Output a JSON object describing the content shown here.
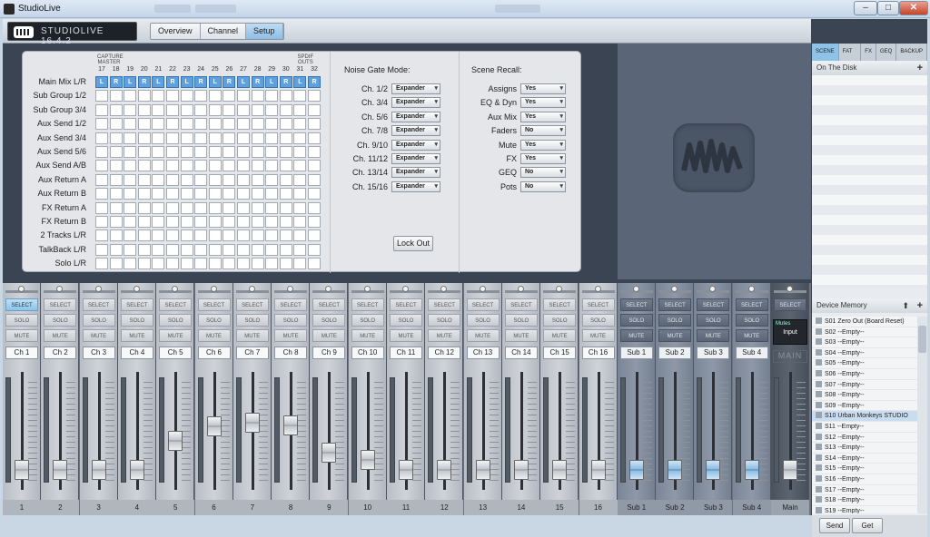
{
  "window": {
    "title": "StudioLive"
  },
  "app": {
    "logo_text": "STUDIOLIVE 16.4.2",
    "tabs": [
      "Overview",
      "Channel",
      "Setup"
    ],
    "active_tab": "Setup"
  },
  "routing": {
    "group_labels": [
      "CAPTURE MASTER",
      "SPDIF OUTS"
    ],
    "channels": [
      "17",
      "18",
      "19",
      "20",
      "21",
      "22",
      "23",
      "24",
      "25",
      "26",
      "27",
      "28",
      "29",
      "30",
      "31",
      "32"
    ],
    "main_mix_row": [
      "L",
      "R",
      "L",
      "R",
      "L",
      "R",
      "L",
      "R",
      "L",
      "R",
      "L",
      "R",
      "L",
      "R",
      "L",
      "R"
    ],
    "rows": [
      "Main Mix L/R",
      "Sub Group 1/2",
      "Sub Group 3/4",
      "Aux Send 1/2",
      "Aux Send 3/4",
      "Aux Send 5/6",
      "Aux Send A/B",
      "Aux Return A",
      "Aux Return B",
      "FX Return A",
      "FX Return B",
      "2 Tracks L/R",
      "TalkBack L/R",
      "Solo L/R"
    ]
  },
  "noise_gate": {
    "title": "Noise Gate Mode:",
    "items": [
      {
        "label": "Ch. 1/2",
        "value": "Expander"
      },
      {
        "label": "Ch. 3/4",
        "value": "Expander"
      },
      {
        "label": "Ch. 5/6",
        "value": "Expander"
      },
      {
        "label": "Ch. 7/8",
        "value": "Expander"
      },
      {
        "label": "Ch. 9/10",
        "value": "Expander"
      },
      {
        "label": "Ch. 11/12",
        "value": "Expander"
      },
      {
        "label": "Ch. 13/14",
        "value": "Expander"
      },
      {
        "label": "Ch. 15/16",
        "value": "Expander"
      }
    ],
    "lock_out": "Lock Out"
  },
  "scene_recall": {
    "title": "Scene Recall:",
    "items": [
      {
        "label": "Assigns",
        "value": "Yes"
      },
      {
        "label": "EQ & Dyn",
        "value": "Yes"
      },
      {
        "label": "Aux Mix",
        "value": "Yes"
      },
      {
        "label": "Faders",
        "value": "No"
      },
      {
        "label": "Mute",
        "value": "Yes"
      },
      {
        "label": "FX",
        "value": "Yes"
      },
      {
        "label": "GEQ",
        "value": "No"
      },
      {
        "label": "Pots",
        "value": "No"
      }
    ]
  },
  "right_panel": {
    "tabs": [
      "SCENE",
      "FAT CH",
      "FX",
      "GEQ",
      "BACKUP"
    ],
    "active_tab": "SCENE",
    "on_disk": "On The Disk",
    "device_memory": "Device Memory",
    "memory": [
      "S01 Zero Out (Board Reset)",
      "S02 --Empty--",
      "S03 --Empty--",
      "S04 --Empty--",
      "S05 --Empty--",
      "S06 --Empty--",
      "S07 --Empty--",
      "S08 --Empty--",
      "S09 --Empty--",
      "S10 Urban Monkeys STUDIO",
      "S11 --Empty--",
      "S12 --Empty--",
      "S13 --Empty--",
      "S14 --Empty--",
      "S15 --Empty--",
      "S16 --Empty--",
      "S17 --Empty--",
      "S18 --Empty--",
      "S19 --Empty--"
    ],
    "selected_memory": "S10 Urban Monkeys STUDIO",
    "send": "Send",
    "get": "Get"
  },
  "mixer": {
    "select": "SELECT",
    "solo": "SOLO",
    "mute": "MUTE",
    "mutes_label": "Mutes",
    "input_label": "Input",
    "main_label": "MAIN",
    "channels": [
      {
        "name": "Ch 1",
        "num": "1",
        "fader": 0.1,
        "selected": true
      },
      {
        "name": "Ch 2",
        "num": "2",
        "fader": 0.1
      },
      {
        "name": "Ch 3",
        "num": "3",
        "fader": 0.1
      },
      {
        "name": "Ch 4",
        "num": "4",
        "fader": 0.1
      },
      {
        "name": "Ch 5",
        "num": "5",
        "fader": 0.4
      },
      {
        "name": "Ch 6",
        "num": "6",
        "fader": 0.55
      },
      {
        "name": "Ch 7",
        "num": "7",
        "fader": 0.58
      },
      {
        "name": "Ch 8",
        "num": "8",
        "fader": 0.56
      },
      {
        "name": "Ch 9",
        "num": "9",
        "fader": 0.28
      },
      {
        "name": "Ch 10",
        "num": "10",
        "fader": 0.2
      },
      {
        "name": "Ch 11",
        "num": "11",
        "fader": 0.1
      },
      {
        "name": "Ch 12",
        "num": "12",
        "fader": 0.1
      },
      {
        "name": "Ch 13",
        "num": "13",
        "fader": 0.1
      },
      {
        "name": "Ch 14",
        "num": "14",
        "fader": 0.1
      },
      {
        "name": "Ch 15",
        "num": "15",
        "fader": 0.1
      },
      {
        "name": "Ch 16",
        "num": "16",
        "fader": 0.1
      },
      {
        "name": "Sub 1",
        "num": "Sub 1",
        "fader": 0.1,
        "type": "sub"
      },
      {
        "name": "Sub 2",
        "num": "Sub 2",
        "fader": 0.1,
        "type": "sub"
      },
      {
        "name": "Sub 3",
        "num": "Sub 3",
        "fader": 0.1,
        "type": "sub"
      },
      {
        "name": "Sub 4",
        "num": "Sub 4",
        "fader": 0.1,
        "type": "sub"
      },
      {
        "name": "MAIN",
        "num": "Main",
        "fader": 0.1,
        "type": "main"
      }
    ]
  }
}
